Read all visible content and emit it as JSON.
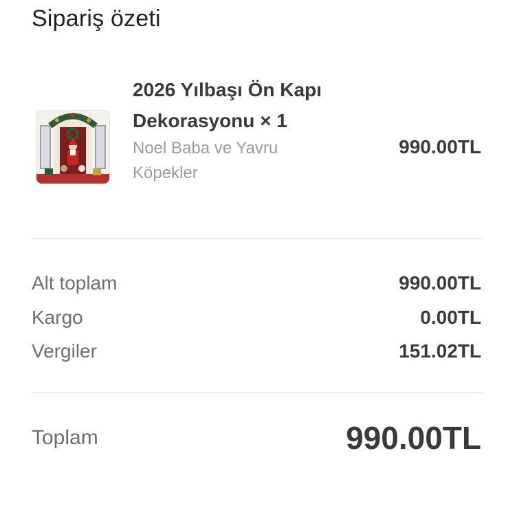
{
  "summary": {
    "title": "Sipariş özeti"
  },
  "item": {
    "name": "2026 Yılbaşı Ön Kapı Dekorasyonu × 1",
    "variant": "Noel Baba ve Yavru Köpekler",
    "price": "990.00TL",
    "thumbnail_icon": "christmas-door-decoration-image"
  },
  "totals": {
    "subtotal_label": "Alt toplam",
    "subtotal_value": "990.00TL",
    "shipping_label": "Kargo",
    "shipping_value": "0.00TL",
    "taxes_label": "Vergiler",
    "taxes_value": "151.02TL",
    "total_label": "Toplam",
    "total_value": "990.00TL"
  }
}
